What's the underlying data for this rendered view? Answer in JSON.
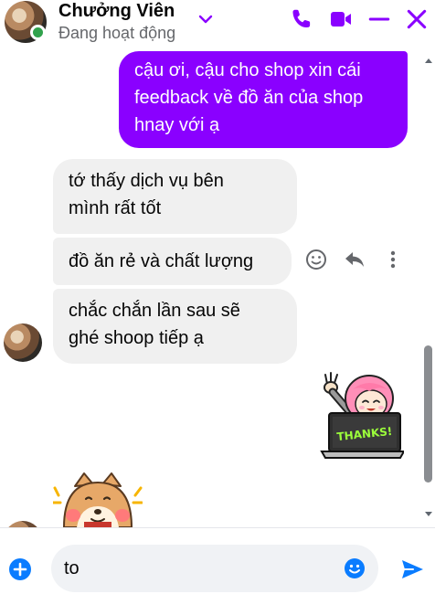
{
  "header": {
    "contact_name": "Chưởng Viên",
    "status": "Đang hoạt động",
    "accent_color": "#8a00ff",
    "icons": [
      "chevron-down-icon",
      "phone-icon",
      "video-icon",
      "minimize-icon",
      "close-icon"
    ]
  },
  "messages": [
    {
      "direction": "outgoing",
      "text_lines": [
        "cậu ơi, cậu cho shop xin cái",
        "feedback về đồ ăn của shop",
        "hnay với ạ"
      ]
    },
    {
      "direction": "incoming",
      "text_lines": [
        "tớ thấy dịch vụ bên",
        "mình rất tốt"
      ]
    },
    {
      "direction": "incoming",
      "text_lines": [
        "đồ ăn rẻ và chất lượng"
      ]
    },
    {
      "direction": "incoming",
      "text_lines": [
        "chắc chắn lần sau sẽ",
        "ghé shoop tiếp ạ"
      ]
    }
  ],
  "message_actions": [
    "react-icon",
    "reply-icon",
    "more-icon"
  ],
  "stickers": [
    {
      "direction": "outgoing",
      "name": "thanks-girl-laptop-sticker",
      "caption": "THANKS!"
    },
    {
      "direction": "incoming",
      "name": "shiba-dog-sticker"
    }
  ],
  "composer": {
    "input_value": "to",
    "icons": [
      "plus-circle-icon",
      "emoji-icon",
      "send-icon"
    ]
  },
  "colors": {
    "outgoing_bubble": "#8a00ff",
    "incoming_bubble": "#f0f0f0",
    "online": "#31a24c",
    "send": "#0a7cff"
  }
}
